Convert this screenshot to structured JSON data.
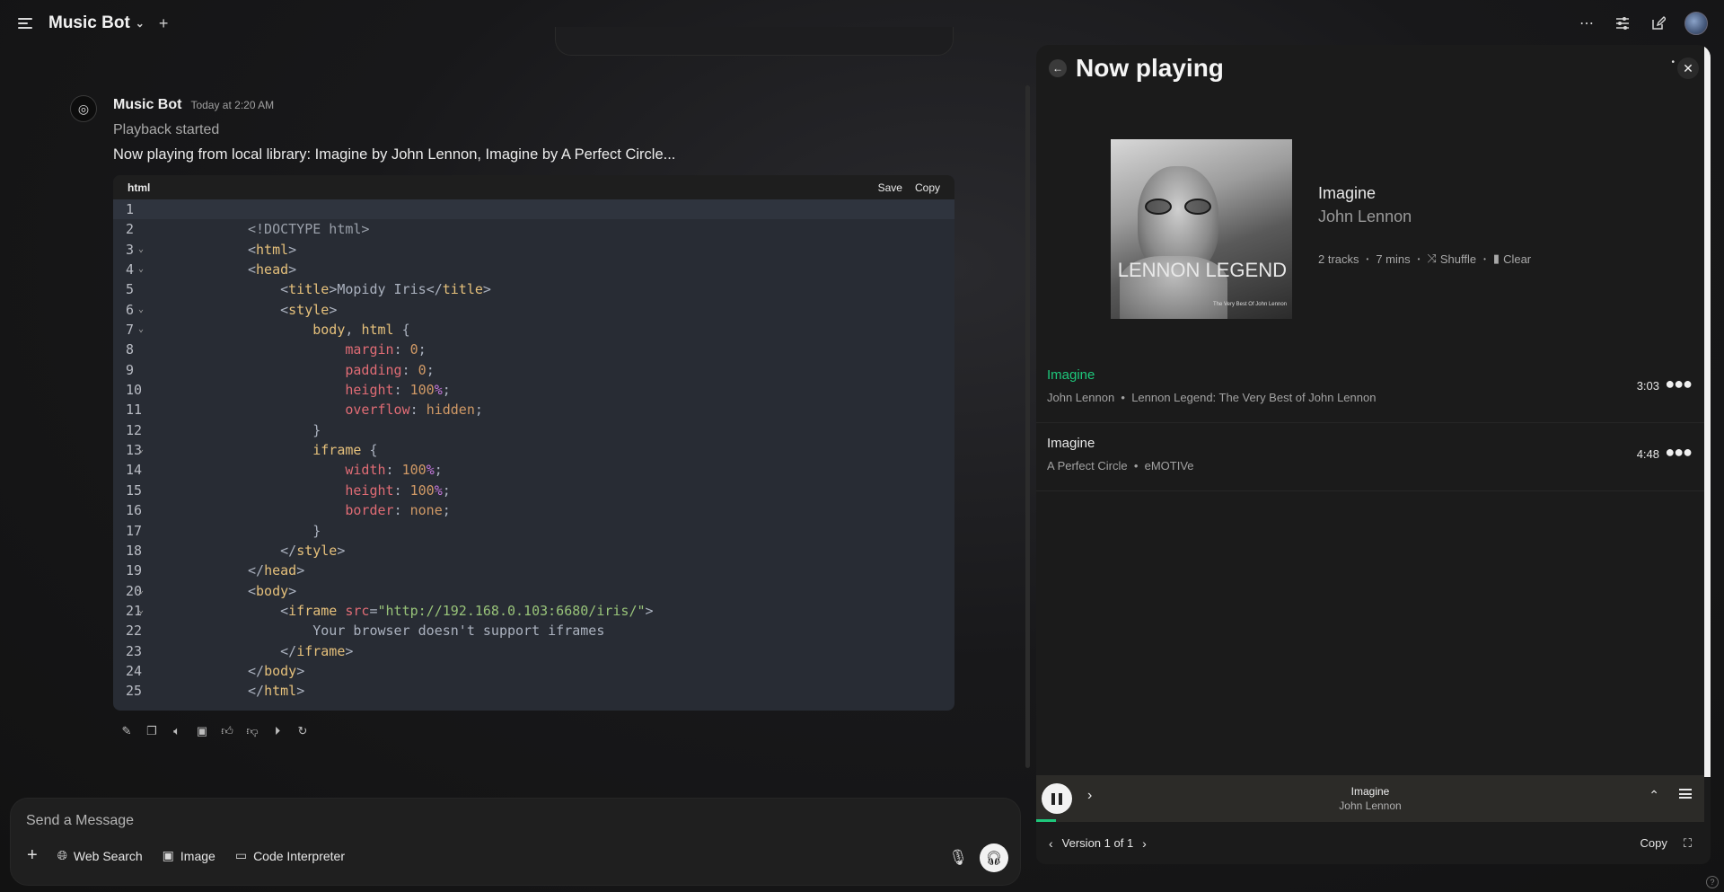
{
  "header": {
    "model_name": "Music Bot"
  },
  "message": {
    "author": "Music Bot",
    "time": "Today at 2:20 AM",
    "status": "Playback started",
    "text": "Now playing from local library: Imagine by John Lennon, Imagine by A Perfect Circle..."
  },
  "code": {
    "lang": "html",
    "save_label": "Save",
    "copy_label": "Copy",
    "line_numbers": [
      "1",
      "2",
      "3",
      "4",
      "5",
      "6",
      "7",
      "8",
      "9",
      "10",
      "11",
      "12",
      "13",
      "14",
      "15",
      "16",
      "17",
      "18",
      "19",
      "20",
      "21",
      "22",
      "23",
      "24",
      "25"
    ],
    "text": {
      "doctype": "<!DOCTYPE html>",
      "title_text": "Mopidy Iris",
      "src_url": "\"http://192.168.0.103:6680/iris/\"",
      "fallback": "Your browser doesn't support iframes"
    }
  },
  "input": {
    "placeholder": "Send a Message",
    "web_search": "Web Search",
    "image": "Image",
    "code_interpreter": "Code Interpreter"
  },
  "panel": {
    "title": "Now playing",
    "album_cover_text": "LENNON LEGEND",
    "album_cover_subtitle": "The Very Best Of John Lennon",
    "current": {
      "title": "Imagine",
      "artist": "John Lennon"
    },
    "meta": {
      "tracks": "2 tracks",
      "duration": "7 mins",
      "shuffle": "Shuffle",
      "clear": "Clear"
    },
    "tracks": [
      {
        "title": "Imagine",
        "artist": "John Lennon",
        "album": "Lennon Legend: The Very Best of John Lennon",
        "duration": "3:03",
        "playing": true
      },
      {
        "title": "Imagine",
        "artist": "A Perfect Circle",
        "album": "eMOTIVe",
        "duration": "4:48",
        "playing": false
      }
    ],
    "player": {
      "title": "Imagine",
      "artist": "John Lennon",
      "progress": 0.03
    },
    "footer": {
      "version": "Version 1 of 1",
      "copy": "Copy"
    }
  }
}
